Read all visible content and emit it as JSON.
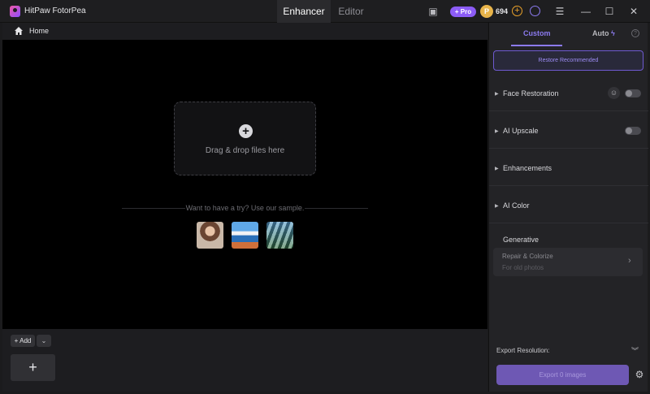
{
  "app": {
    "title": "HitPaw FotorPea"
  },
  "tabs": [
    {
      "label": "Enhancer"
    },
    {
      "label": "Editor"
    }
  ],
  "titlebar": {
    "pro_label": "+ Pro",
    "coin_count": "694",
    "coin_add": "+"
  },
  "breadcrumb": {
    "home": "Home"
  },
  "canvas": {
    "drop_text": "Drag & drop files here",
    "sample_prompt": "Want to have a try? Use our sample."
  },
  "bottom": {
    "add_label": "+ Add",
    "big_add": "+"
  },
  "panel": {
    "tab_custom": "Custom",
    "tab_auto": "Auto",
    "restore_button": "Restore Recommended",
    "sections": [
      {
        "label": "Face Restoration"
      },
      {
        "label": "AI Upscale"
      },
      {
        "label": "Enhancements"
      },
      {
        "label": "AI Color"
      }
    ],
    "generative_label": "Generative",
    "repair_title": "Repair & Colorize",
    "repair_sub": "For old photos",
    "export_resolution": "Export Resolution:",
    "export_button": "Export 0 images"
  },
  "colors": {
    "accent": "#8c7bf0",
    "pro": "#8c5cf6",
    "coin": "#e8b44a"
  }
}
